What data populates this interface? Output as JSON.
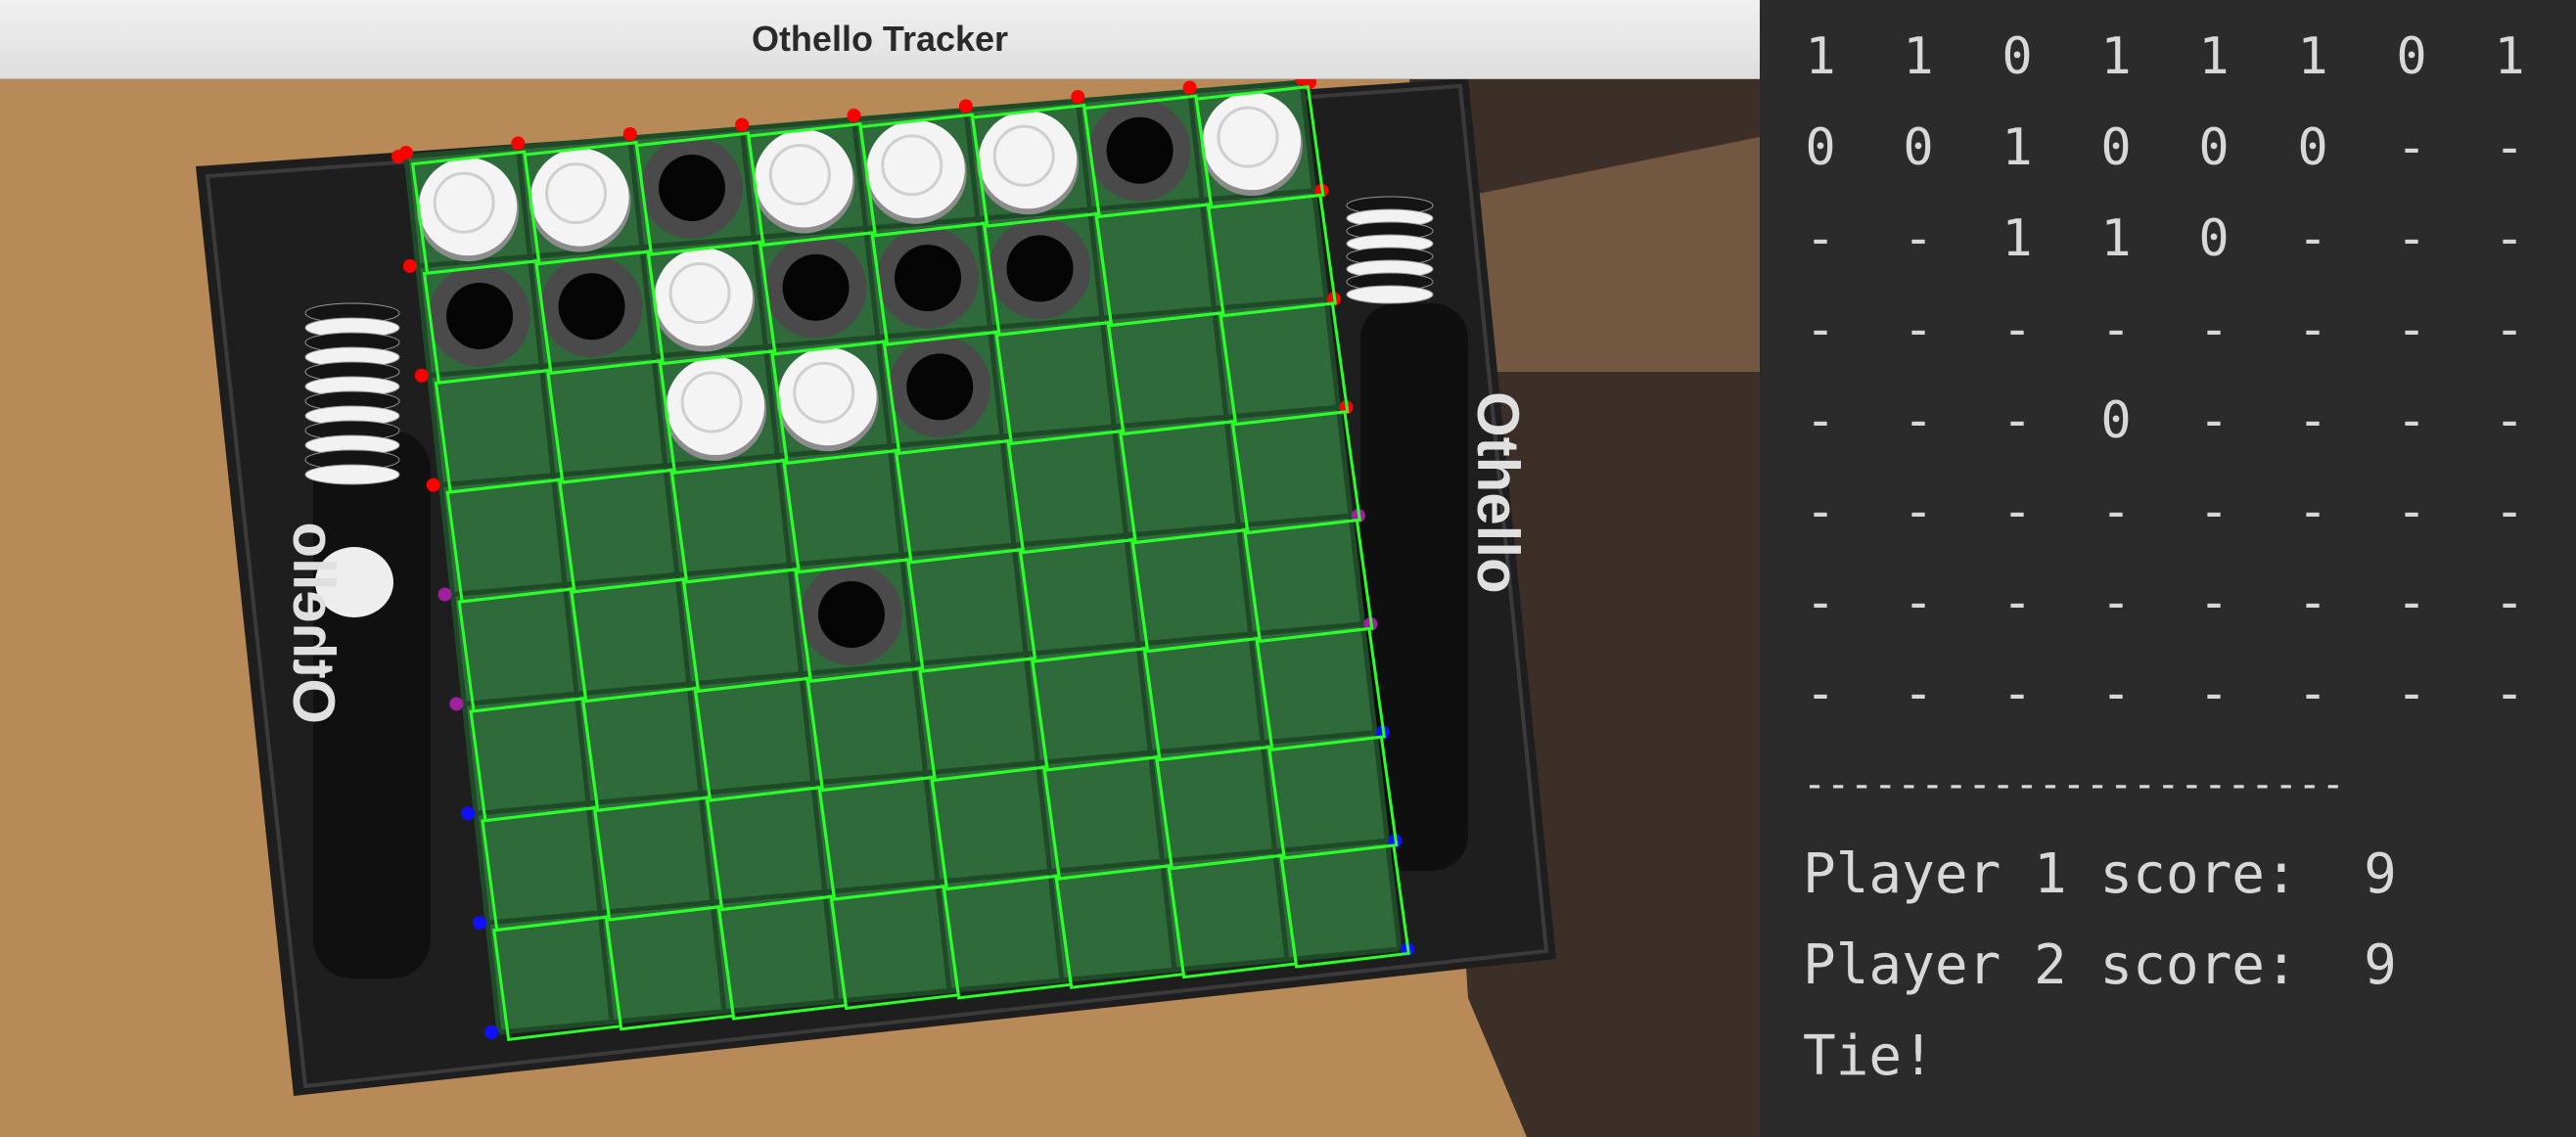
{
  "window": {
    "title": "Othello Tracker"
  },
  "camera_view": {
    "board_brand_text": "Othello",
    "board_state": [
      [
        "white",
        "white",
        "black",
        "white",
        "white",
        "white",
        "black",
        "white"
      ],
      [
        "black",
        "black",
        "white",
        "black",
        "black",
        "black",
        "empty",
        "empty"
      ],
      [
        "empty",
        "empty",
        "white",
        "white",
        "black",
        "empty",
        "empty",
        "empty"
      ],
      [
        "empty",
        "empty",
        "empty",
        "empty",
        "empty",
        "empty",
        "empty",
        "empty"
      ],
      [
        "empty",
        "empty",
        "empty",
        "black",
        "empty",
        "empty",
        "empty",
        "empty"
      ],
      [
        "empty",
        "empty",
        "empty",
        "empty",
        "empty",
        "empty",
        "empty",
        "empty"
      ],
      [
        "empty",
        "empty",
        "empty",
        "empty",
        "empty",
        "empty",
        "empty",
        "empty"
      ],
      [
        "empty",
        "empty",
        "empty",
        "empty",
        "empty",
        "empty",
        "empty",
        "empty"
      ]
    ],
    "colors": {
      "table": "#b88a58",
      "board_frame": "#1e1e1e",
      "board_felt": "#2f6b3a",
      "detection_box": "#2aff2a",
      "corner_marker_top": "#ff0000",
      "corner_marker_bottom": "#1010ff"
    }
  },
  "console": {
    "grid": [
      [
        "1",
        "1",
        "0",
        "1",
        "1",
        "1",
        "0",
        "1"
      ],
      [
        "0",
        "0",
        "1",
        "0",
        "0",
        "0",
        "-",
        "-"
      ],
      [
        "-",
        "-",
        "1",
        "1",
        "0",
        "-",
        "-",
        "-"
      ],
      [
        "-",
        "-",
        "-",
        "-",
        "-",
        "-",
        "-",
        "-"
      ],
      [
        "-",
        "-",
        "-",
        "0",
        "-",
        "-",
        "-",
        "-"
      ],
      [
        "-",
        "-",
        "-",
        "-",
        "-",
        "-",
        "-",
        "-"
      ],
      [
        "-",
        "-",
        "-",
        "-",
        "-",
        "-",
        "-",
        "-"
      ],
      [
        "-",
        "-",
        "-",
        "-",
        "-",
        "-",
        "-",
        "-"
      ]
    ],
    "divider": "-----------------------",
    "player1_score": "Player 1 score:  9",
    "player2_score": "Player 2 score:  9",
    "result": "Tie!"
  }
}
